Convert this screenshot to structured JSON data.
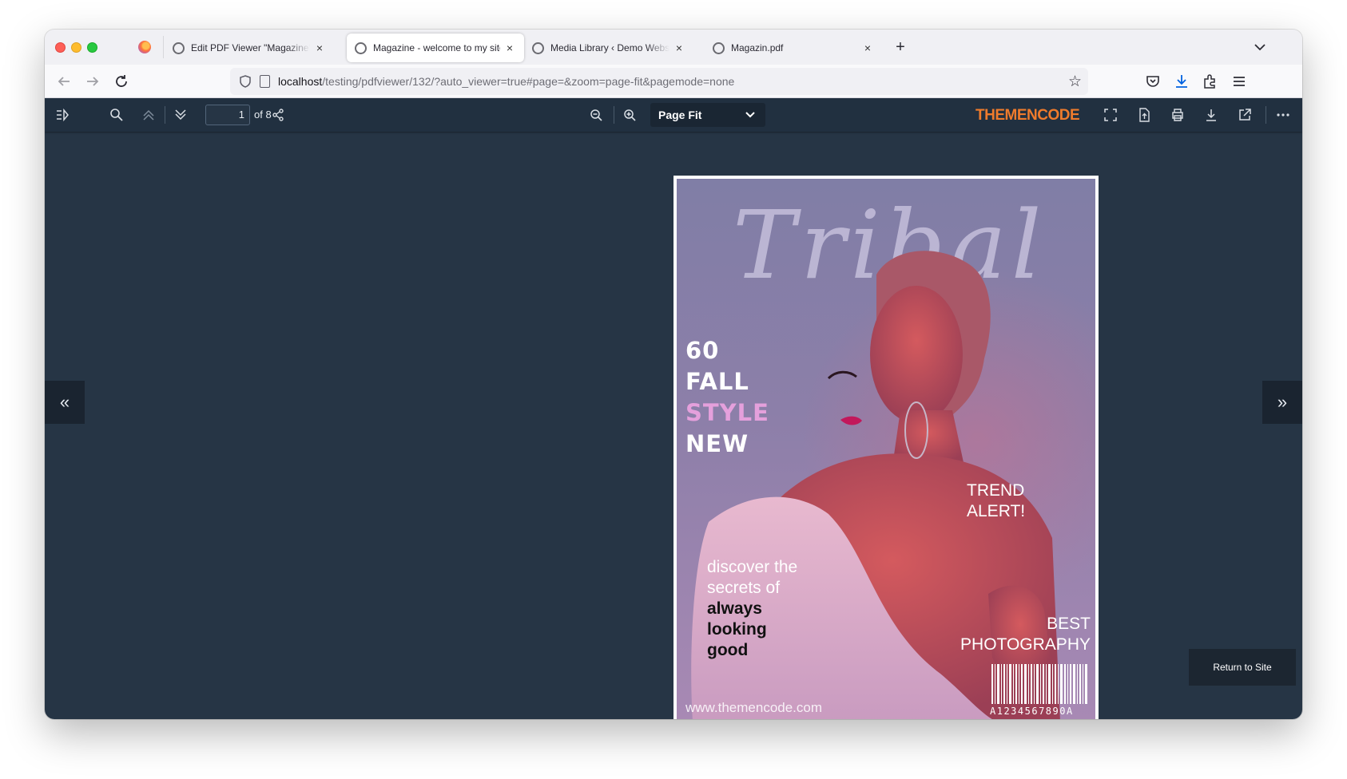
{
  "tabs": [
    {
      "label": "Edit PDF Viewer \"Magazine\" ‹ w",
      "active": false
    },
    {
      "label": "Magazine - welcome to my site",
      "active": true
    },
    {
      "label": "Media Library ‹ Demo Website —",
      "active": false
    },
    {
      "label": "Magazin.pdf",
      "active": false
    }
  ],
  "tab_close_glyph": "×",
  "newtab_glyph": "+",
  "url": {
    "host": "localhost",
    "path": "/testing/pdfviewer/132/?auto_viewer=true#page=&zoom=page-fit&pagemode=none"
  },
  "viewer": {
    "current_page": "1",
    "page_count_label": "of 8",
    "zoom_label": "Page Fit",
    "brand": "THEMENCODE",
    "return_label": "Return to Site",
    "prev_glyph": "«",
    "next_glyph": "»"
  },
  "cover": {
    "script_title": "Tribal",
    "headline": [
      "60",
      "FALL",
      "STYLE",
      "NEW"
    ],
    "trend": [
      "TREND",
      "ALERT!"
    ],
    "discover_plain": [
      "discover the",
      "secrets of"
    ],
    "discover_bold": [
      "always",
      "looking",
      "good"
    ],
    "best": [
      "BEST",
      "PHOTOGRAPHY"
    ],
    "barcode_number": "A1234567890A",
    "site": "www.themencode.com"
  },
  "colors": {
    "viewer_bg": "#263545",
    "toolbar_bg": "#213040",
    "brand": "#ef7b2c",
    "accent_pink": "#e5a0dc"
  }
}
